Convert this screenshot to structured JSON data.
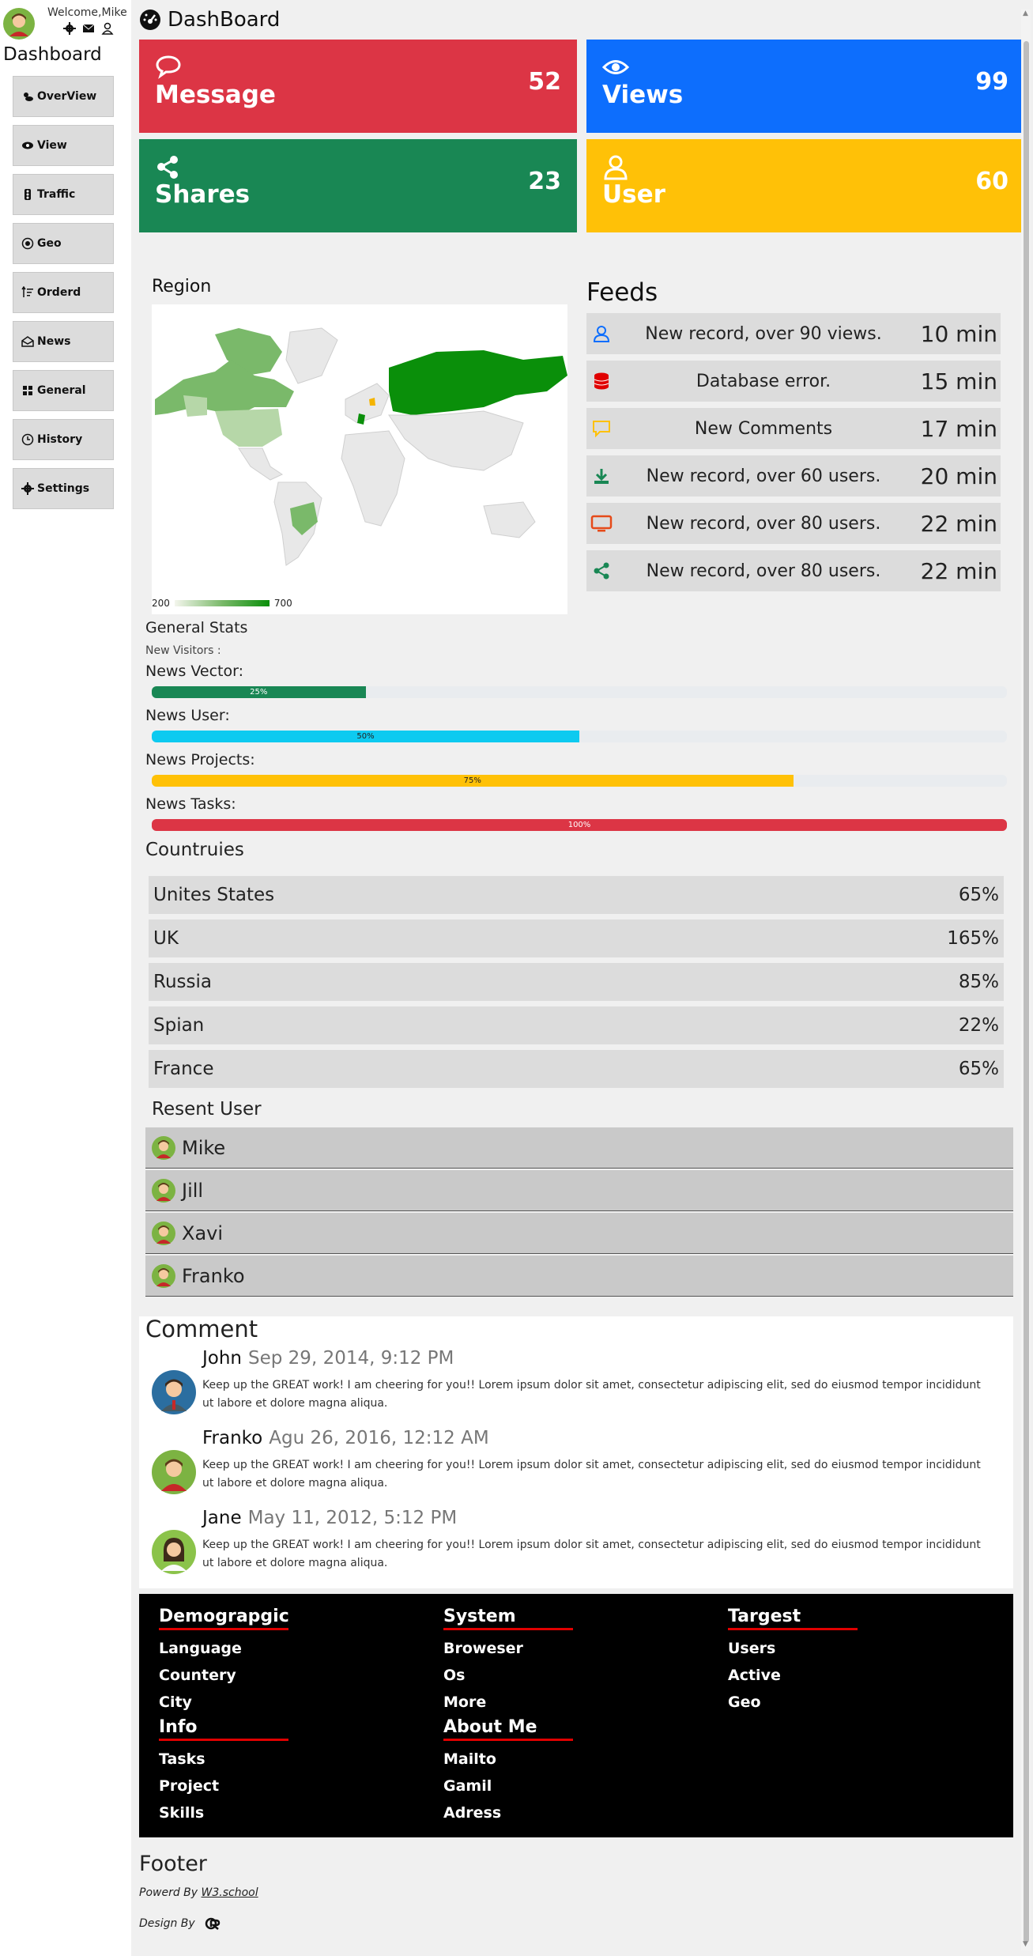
{
  "sidebar": {
    "welcome": "Welcome,Mike",
    "title": "Dashboard",
    "items": [
      {
        "label": "OverView",
        "icon": "cloud-sun-icon"
      },
      {
        "label": "View",
        "icon": "eye-icon"
      },
      {
        "label": "Traffic",
        "icon": "traffic-light-icon"
      },
      {
        "label": "Geo",
        "icon": "target-icon"
      },
      {
        "label": "Orderd",
        "icon": "sort-icon"
      },
      {
        "label": "News",
        "icon": "envelope-open-icon"
      },
      {
        "label": "General",
        "icon": "grid-icon"
      },
      {
        "label": "History",
        "icon": "history-icon"
      },
      {
        "label": "Settings",
        "icon": "gear-icon"
      }
    ]
  },
  "header": {
    "title": "DashBoard"
  },
  "cards": [
    {
      "label": "Message",
      "value": "52",
      "color": "#dc3545",
      "icon": "chat-icon"
    },
    {
      "label": "Views",
      "value": "99",
      "color": "#0d6efd",
      "icon": "eye-icon"
    },
    {
      "label": "Shares",
      "value": "23",
      "color": "#198754",
      "icon": "share-icon"
    },
    {
      "label": "User",
      "value": "60",
      "color": "#ffc107",
      "icon": "user-icon"
    }
  ],
  "region": {
    "title": "Region",
    "legend_min": "200",
    "legend_max": "700"
  },
  "feeds": {
    "title": "Feeds",
    "items": [
      {
        "text": "New record, over 90 views.",
        "time": "10 min",
        "icon": "user-icon",
        "color": "#0d6efd"
      },
      {
        "text": "Database error.",
        "time": "15 min",
        "icon": "database-icon",
        "color": "#e00000"
      },
      {
        "text": "New Comments",
        "time": "17 min",
        "icon": "comment-icon",
        "color": "#ffc107"
      },
      {
        "text": "New record, over 60 users.",
        "time": "20 min",
        "icon": "download-icon",
        "color": "#198754"
      },
      {
        "text": "New record, over 80 users.",
        "time": "22 min",
        "icon": "monitor-icon",
        "color": "#e64a19"
      },
      {
        "text": "New record, over 80 users.",
        "time": "22 min",
        "icon": "share-icon",
        "color": "#198754"
      }
    ]
  },
  "general_stats": {
    "title": "General Stats",
    "subtitle": "New Visitors :",
    "bars": [
      {
        "label": "News Vector:",
        "value": 25,
        "text": "25%",
        "color": "#198754"
      },
      {
        "label": "News User:",
        "value": 50,
        "text": "50%",
        "color": "#0dcaf0"
      },
      {
        "label": "News Projects:",
        "value": 75,
        "text": "75%",
        "color": "#ffc107"
      },
      {
        "label": "News Tasks:",
        "value": 100,
        "text": "100%",
        "color": "#dc3545"
      }
    ]
  },
  "countries": {
    "title": "Countruies",
    "items": [
      {
        "name": "Unites States",
        "value": "65%"
      },
      {
        "name": "UK",
        "value": "165%"
      },
      {
        "name": "Russia",
        "value": "85%"
      },
      {
        "name": "Spian",
        "value": "22%"
      },
      {
        "name": "France",
        "value": "65%"
      }
    ]
  },
  "recent_users": {
    "title": "Resent User",
    "items": [
      "Mike",
      "Jill",
      "Xavi",
      "Franko"
    ]
  },
  "comments": {
    "title": "Comment",
    "items": [
      {
        "name": "John",
        "date": "Sep 29, 2014, 9:12 PM",
        "text": "Keep up the GREAT work! I am cheering for you!! Lorem ipsum dolor sit amet, consectetur adipiscing elit, sed do eiusmod tempor incididunt ut labore et dolore magna aliqua."
      },
      {
        "name": "Franko",
        "date": "Agu 26, 2016, 12:12 AM",
        "text": "Keep up the GREAT work! I am cheering for you!! Lorem ipsum dolor sit amet, consectetur adipiscing elit, sed do eiusmod tempor incididunt ut labore et dolore magna aliqua."
      },
      {
        "name": "Jane",
        "date": "May 11, 2012, 5:12 PM",
        "text": "Keep up the GREAT work! I am cheering for you!! Lorem ipsum dolor sit amet, consectetur adipiscing elit, sed do eiusmod tempor incididunt ut labore et dolore magna aliqua."
      }
    ]
  },
  "footer": {
    "columns": [
      {
        "title": "Demograpgic",
        "items": [
          "Language",
          "Countery",
          "City"
        ]
      },
      {
        "title": "System",
        "items": [
          "Broweser",
          "Os",
          "More"
        ]
      },
      {
        "title": "Targest",
        "items": [
          "Users",
          "Active",
          "Geo"
        ]
      },
      {
        "title": "Info",
        "items": [
          "Tasks",
          "Project",
          "Skills"
        ]
      },
      {
        "title": "About Me",
        "items": [
          "Mailto",
          "Gamil",
          "Adress"
        ]
      }
    ],
    "title": "Footer",
    "powered_prefix": "Powerd By",
    "powered_link": "W3.school",
    "design_by": "Design By"
  }
}
